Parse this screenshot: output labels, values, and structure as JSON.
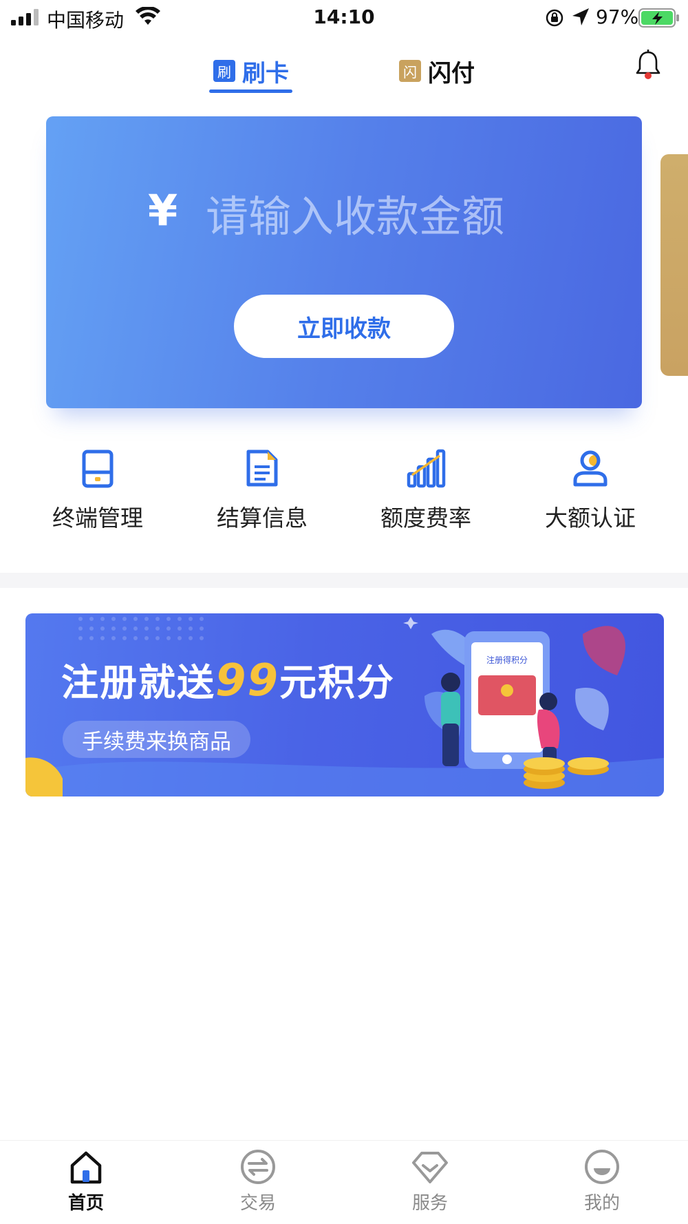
{
  "status_bar": {
    "carrier": "中国移动",
    "time": "14:10",
    "battery": "97%"
  },
  "top_tabs": [
    {
      "icon_char": "刷",
      "label": "刷卡",
      "active": true
    },
    {
      "icon_char": "闪",
      "label": "闪付",
      "active": false
    }
  ],
  "collection": {
    "currency_symbol": "¥",
    "amount_placeholder": "请输入收款金额",
    "button_label": "立即收款"
  },
  "quick_actions": [
    {
      "label": "终端管理",
      "icon": "terminal-icon"
    },
    {
      "label": "结算信息",
      "icon": "document-icon"
    },
    {
      "label": "额度费率",
      "icon": "bar-chart-icon"
    },
    {
      "label": "大额认证",
      "icon": "user-verify-icon"
    }
  ],
  "banner": {
    "headline_prefix": "注册就送",
    "headline_number": "99",
    "headline_suffix": "元积分",
    "sub": "手续费来换商品",
    "phone_text": "注册得积分"
  },
  "bottom_nav": [
    {
      "label": "首页",
      "icon": "home-icon",
      "active": true
    },
    {
      "label": "交易",
      "icon": "exchange-icon",
      "active": false
    },
    {
      "label": "服务",
      "icon": "diamond-icon",
      "active": false
    },
    {
      "label": "我的",
      "icon": "profile-icon",
      "active": false
    }
  ],
  "colors": {
    "accent": "#2f6ee9",
    "gold": "#c9a25e",
    "notification_dot": "#e53935"
  }
}
